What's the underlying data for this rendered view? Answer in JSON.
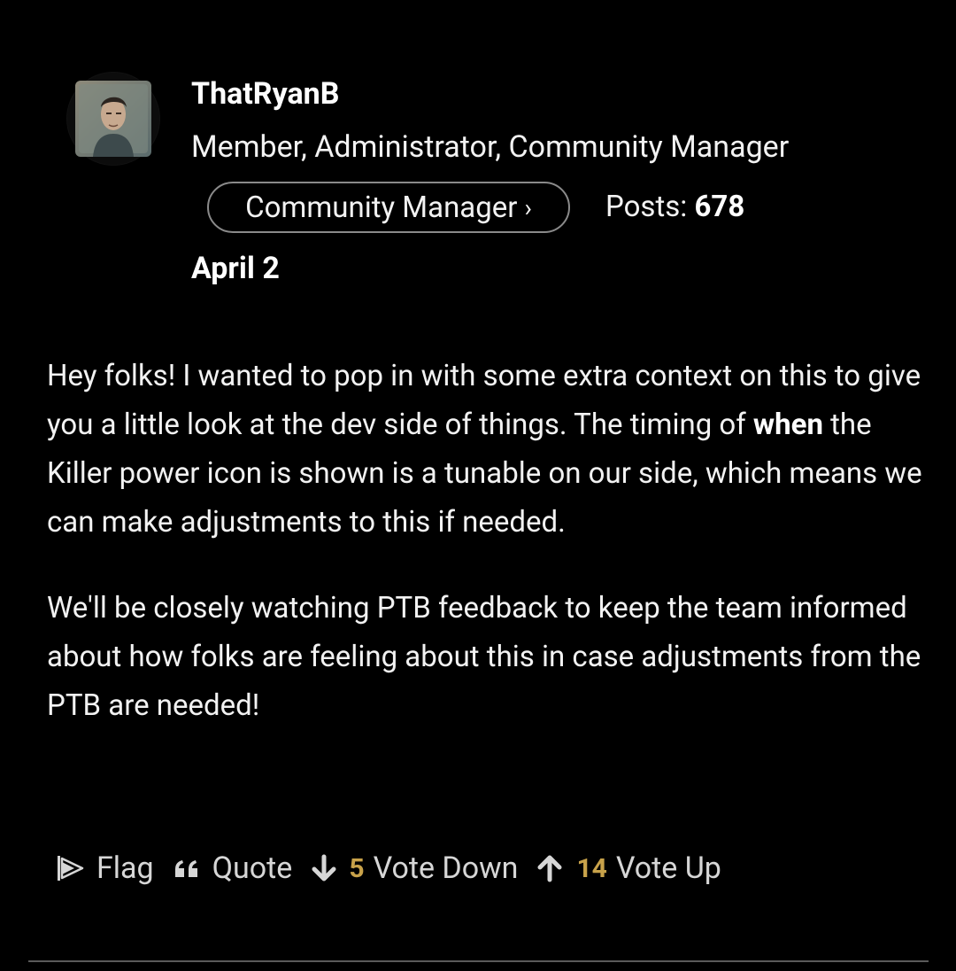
{
  "author": {
    "avatar_icon": "user-avatar-icon",
    "username": "ThatRyanB",
    "roles": "Member, Administrator, Community Manager",
    "rank_label": "Community Manager",
    "rank_chevron": "›",
    "posts_label": "Posts:",
    "posts_count": "678"
  },
  "post": {
    "date": "April 2",
    "paragraph1_before": "Hey folks! I wanted to pop in with some extra context on this to give you a little look at the dev side of things. The timing of ",
    "paragraph1_bold": "when",
    "paragraph1_after": " the Killer power icon is shown is a tunable on our side, which means we can make adjustments to this if needed.",
    "paragraph2": "We'll be closely watching PTB feedback to keep the team informed about how folks are feeling about this in case adjustments from the PTB are needed!"
  },
  "actions": {
    "flag_label": "Flag",
    "quote_label": "Quote",
    "vote_down_count": "5",
    "vote_down_label": "Vote Down",
    "vote_up_count": "14",
    "vote_up_label": "Vote Up"
  },
  "colors": {
    "background": "#000000",
    "text": "#f2f2f2",
    "count_accent": "#c8a24a",
    "pill_border": "#8a8a8a"
  }
}
